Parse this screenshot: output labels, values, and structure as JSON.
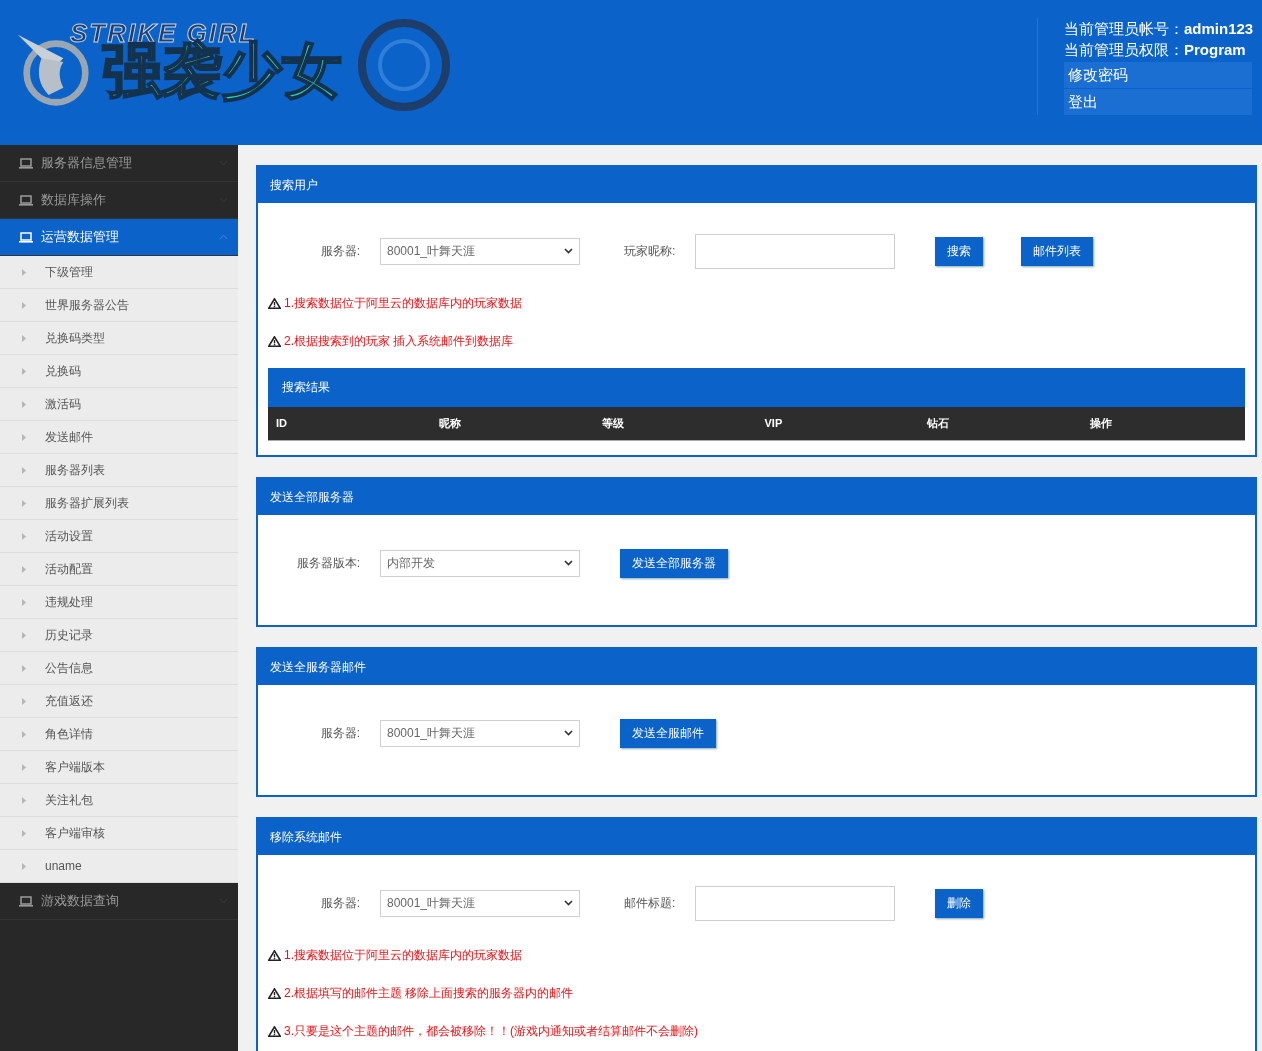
{
  "header": {
    "logo": {
      "latin": "STRIKE GIRL",
      "title": "强袭少女"
    },
    "account": [
      {
        "label": "当前管理员帐号：",
        "value": "admin123"
      },
      {
        "label": "当前管理员权限：",
        "value": "Program"
      }
    ],
    "links": [
      "修改密码",
      "登出"
    ]
  },
  "sidebar": {
    "items": [
      {
        "label": "服务器信息管理",
        "selected": false,
        "expanded": false
      },
      {
        "label": "数据库操作",
        "selected": false,
        "expanded": false
      },
      {
        "label": "运营数据管理",
        "selected": true,
        "expanded": true,
        "children": [
          "下级管理",
          "世界服务器公告",
          "兑换码类型",
          "兑换码",
          "激活码",
          "发送邮件",
          "服务器列表",
          "服务器扩展列表",
          "活动设置",
          "活动配置",
          "违规处理",
          "历史记录",
          "公告信息",
          "充值返还",
          "角色详情",
          "客户端版本",
          "关注礼包",
          "客户端审核",
          "uname"
        ]
      },
      {
        "label": "游戏数据查询",
        "selected": false,
        "expanded": false
      }
    ]
  },
  "panels": [
    {
      "title": "搜索用户",
      "controls": [
        {
          "kind": "select",
          "label": "服务器:",
          "value": "80001_叶舞天涯"
        },
        {
          "kind": "input",
          "label": "玩家昵称:"
        },
        {
          "kind": "button",
          "label": "搜索"
        },
        {
          "kind": "button",
          "label": "邮件列表"
        }
      ],
      "notes": [
        "1.搜索数据位于阿里云的数据库内的玩家数据",
        "2.根据搜索到的玩家 插入系统邮件到数据库"
      ],
      "results": {
        "title": "搜索结果",
        "columns": [
          "ID",
          "昵称",
          "等级",
          "VIP",
          "钻石",
          "操作"
        ]
      }
    },
    {
      "title": "发送全部服务器",
      "controls": [
        {
          "kind": "select",
          "label": "服务器版本:",
          "value": "内部开发"
        },
        {
          "kind": "button",
          "label": "发送全部服务器"
        }
      ]
    },
    {
      "title": "发送全服务器邮件",
      "controls": [
        {
          "kind": "select",
          "label": "服务器:",
          "value": "80001_叶舞天涯"
        },
        {
          "kind": "button",
          "label": "发送全服邮件"
        }
      ]
    },
    {
      "title": "移除系统邮件",
      "controls": [
        {
          "kind": "select",
          "label": "服务器:",
          "value": "80001_叶舞天涯"
        },
        {
          "kind": "input",
          "label": "邮件标题:"
        },
        {
          "kind": "button",
          "label": "删除"
        }
      ],
      "notes": [
        "1.搜索数据位于阿里云的数据库内的玩家数据",
        "2.根据填写的邮件主题 移除上面搜索的服务器内的邮件",
        "3.只要是这个主题的邮件，都会被移除！！(游戏内通知或者结算邮件不会删除)"
      ]
    }
  ]
}
